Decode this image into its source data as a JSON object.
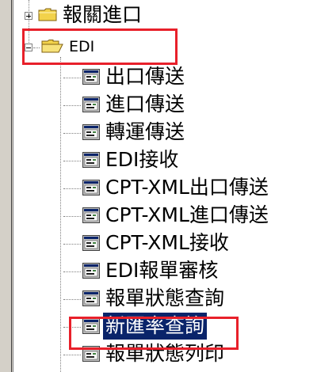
{
  "tree": {
    "customs_import": {
      "label": "報關進口",
      "icon": "folder-closed-icon"
    },
    "edi": {
      "label": "EDI",
      "icon": "folder-open-icon",
      "items": [
        {
          "label": "出口傳送",
          "icon": "form-icon"
        },
        {
          "label": "進口傳送",
          "icon": "form-icon"
        },
        {
          "label": "轉運傳送",
          "icon": "form-icon"
        },
        {
          "label": "EDI接收",
          "icon": "form-icon"
        },
        {
          "label": "CPT-XML出口傳送",
          "icon": "form-icon"
        },
        {
          "label": "CPT-XML進口傳送",
          "icon": "form-icon"
        },
        {
          "label": "CPT-XML接收",
          "icon": "form-icon"
        },
        {
          "label": "EDI報單審核",
          "icon": "form-icon"
        },
        {
          "label": "報單狀態查詢",
          "icon": "form-icon"
        },
        {
          "label": "新匯率查詢",
          "icon": "form-icon",
          "selected": true
        },
        {
          "label": "報單狀態列印",
          "icon": "form-icon"
        }
      ]
    }
  },
  "colors": {
    "selection": "#0a246a",
    "highlight_box": "#e8202a",
    "folder": "#f2d24b"
  }
}
